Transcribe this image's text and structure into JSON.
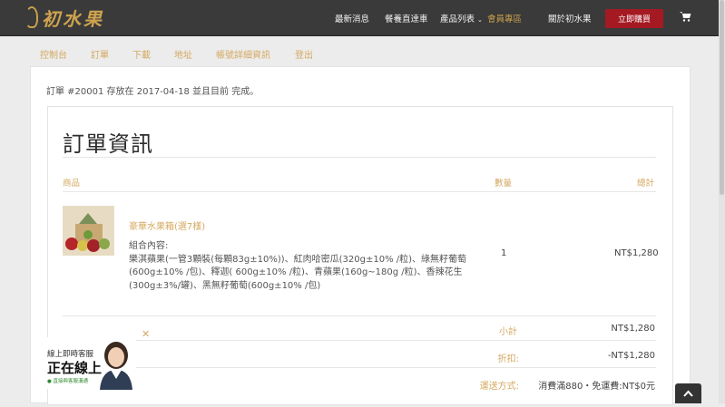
{
  "header": {
    "logo_text": "初水果",
    "nav": [
      {
        "label": "最新消息"
      },
      {
        "label": "餐養直達車"
      },
      {
        "label": "產品列表"
      },
      {
        "label": "會員專區"
      },
      {
        "label": "關於初水果"
      }
    ],
    "buy_button": "立即購買"
  },
  "account_tabs": [
    "控制台",
    "訂單",
    "下載",
    "地址",
    "帳號詳細資訊",
    "登出"
  ],
  "order_intro": "訂單 #20001 存放在 2017-04-18 並且目前 完成。",
  "order_details": {
    "title": "訂單資訊",
    "columns": {
      "product": "商品",
      "qty": "數量",
      "total": "總計"
    },
    "item": {
      "name": "豪華水果箱(選7樣)",
      "desc_label": "組合內容:",
      "desc_lines": [
        "樂淇蘋果(一管3顆裝(每顆83g±10%))、紅肉哈密瓜(320g±10% /粒)、綠無籽葡萄",
        "(600g±10% /包)、釋迦( 600g±10% /粒)、青蘋果(160g~180g /粒)、香辣花生",
        "(300g±3%/罐)、黑無籽葡萄(600g±10% /包)"
      ],
      "qty": "1",
      "total": "NT$1,280"
    },
    "summary": [
      {
        "label": "小計",
        "value": "NT$1,280"
      },
      {
        "label": "折扣:",
        "value": "-NT$1,280"
      },
      {
        "label": "運送方式:",
        "value": "消費滿880・免運費:NT$0元"
      }
    ]
  },
  "chat_widget": {
    "line1": "線上即時客服",
    "line2": "正在線上",
    "line3": "● 直接與客服溝通"
  },
  "colors": {
    "accent": "#d4a960",
    "brand_red": "#a51a22",
    "topbar": "#3a3a3a"
  }
}
